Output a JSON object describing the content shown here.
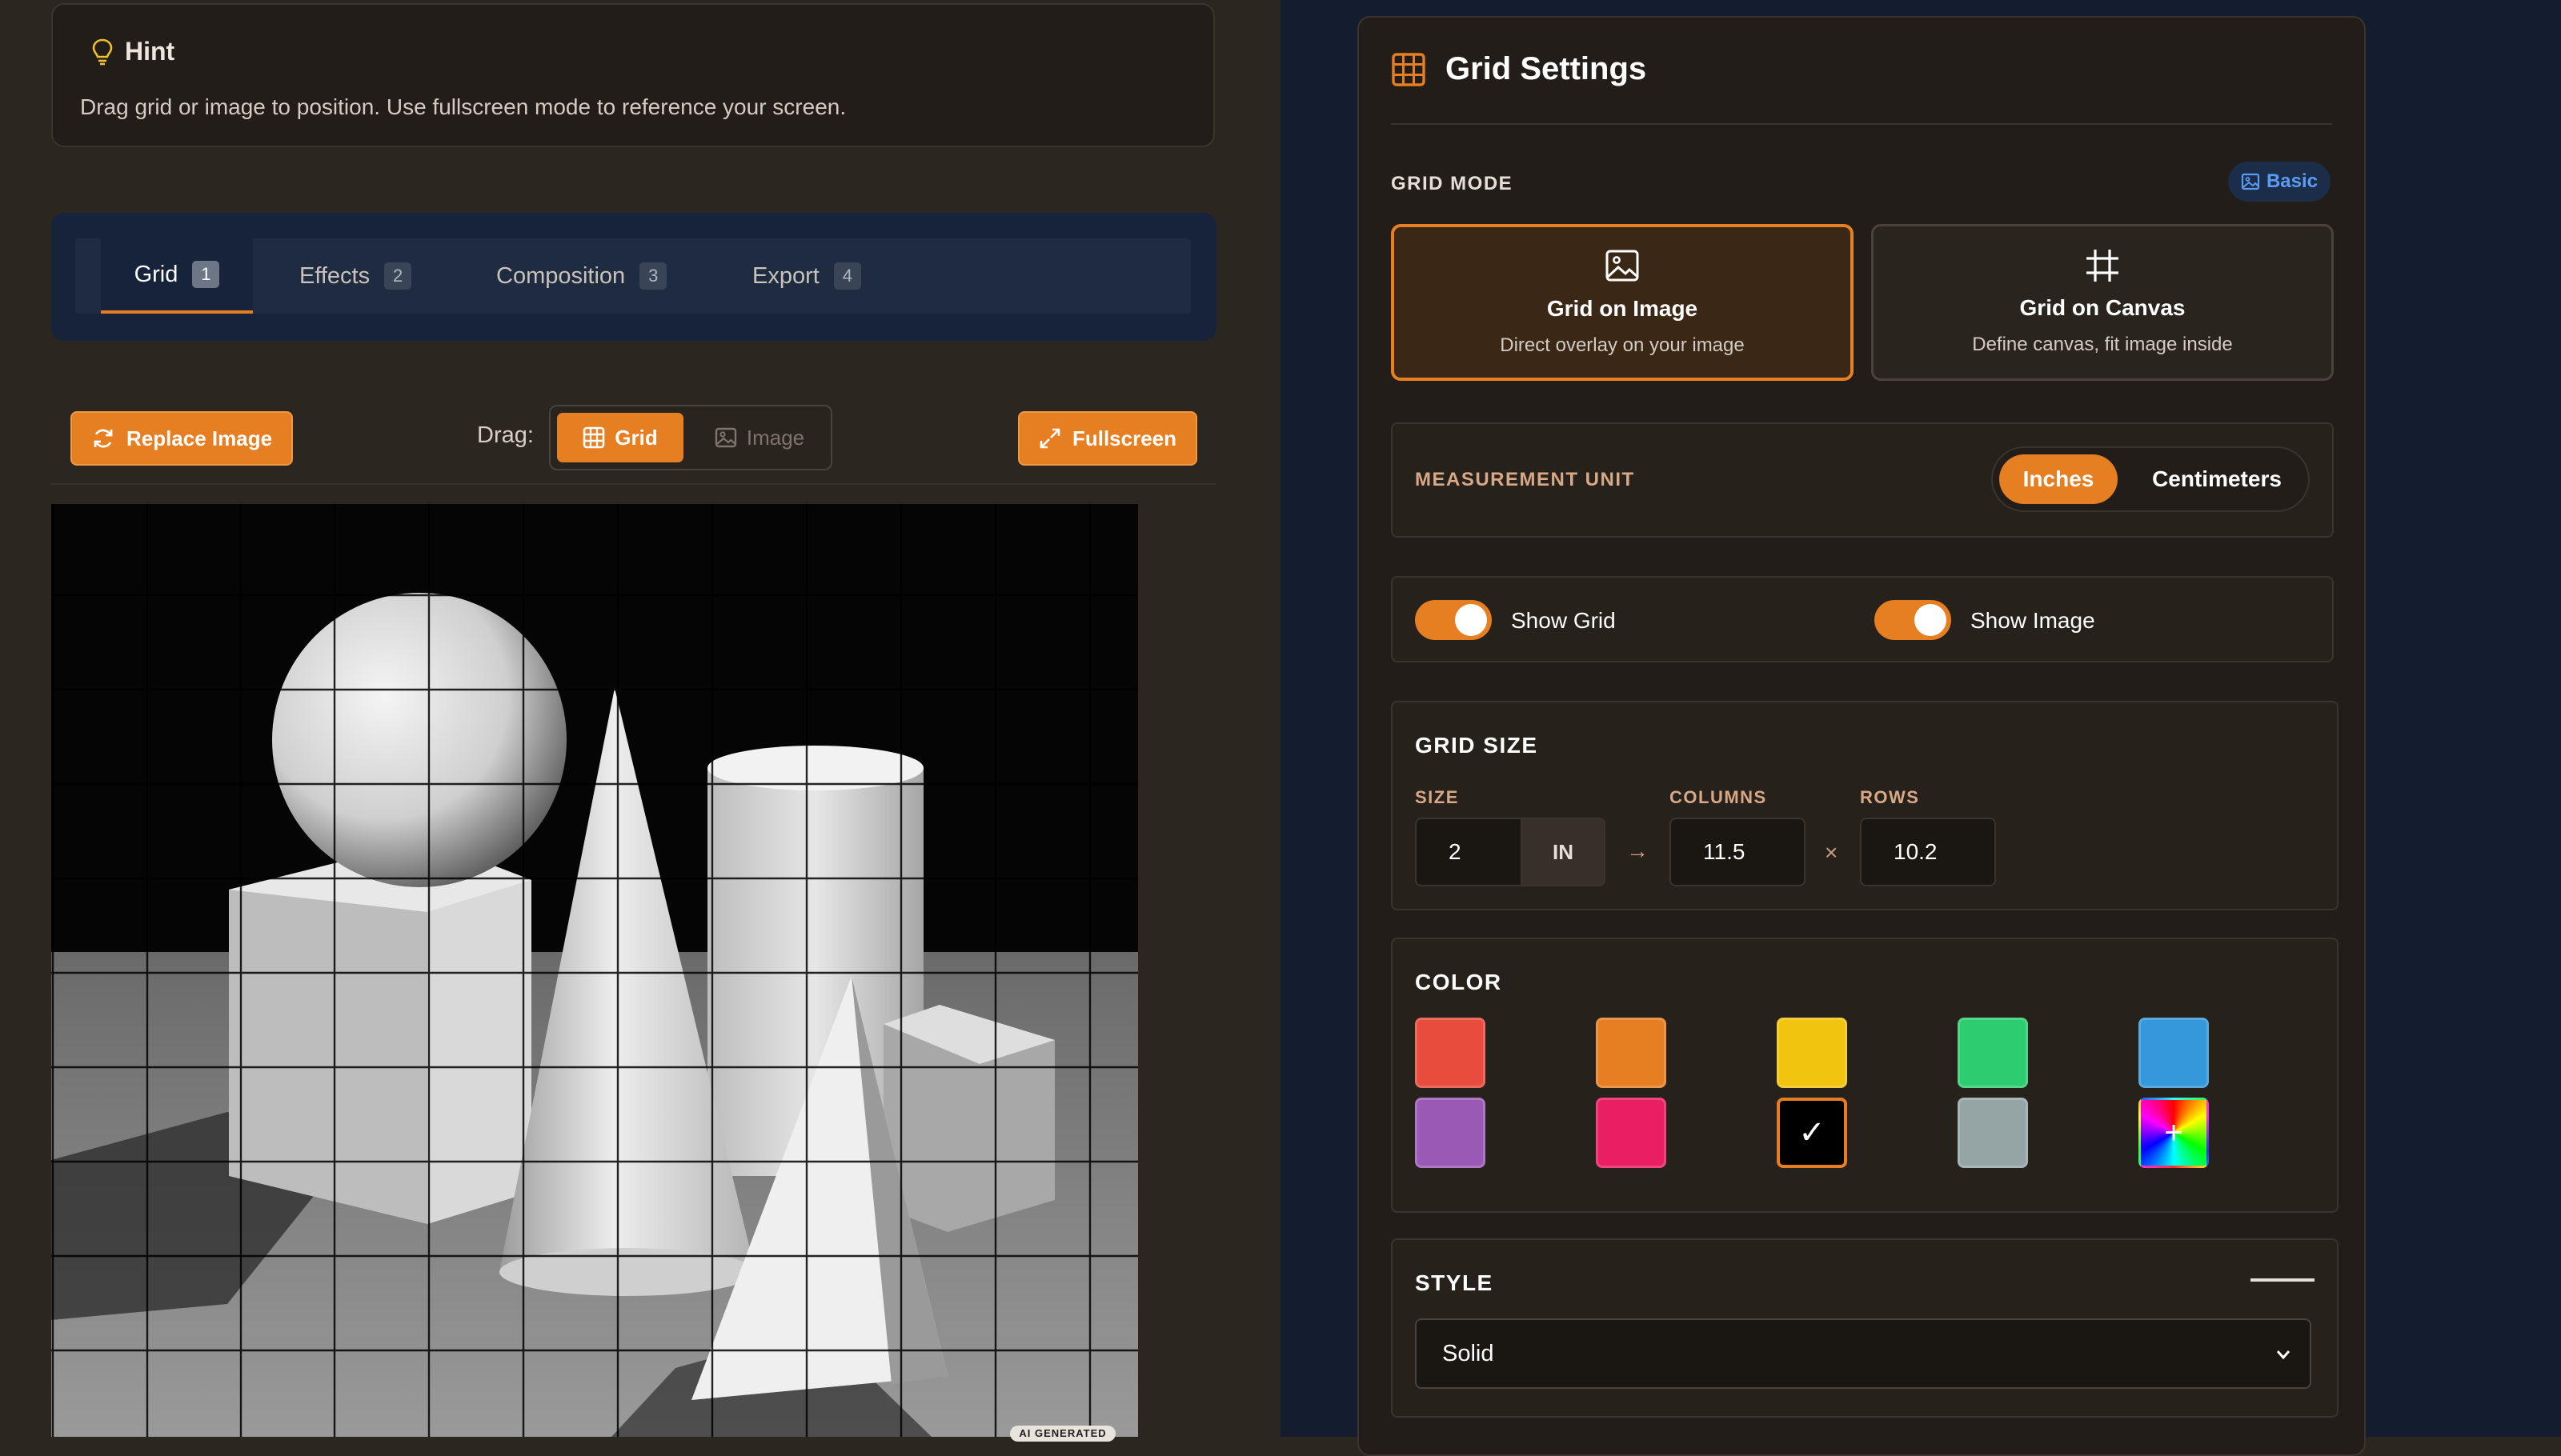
{
  "hint": {
    "title": "Hint",
    "text": "Drag grid or image to position. Use fullscreen mode to reference your screen."
  },
  "tabs": [
    {
      "label": "Grid",
      "num": "1"
    },
    {
      "label": "Effects",
      "num": "2"
    },
    {
      "label": "Composition",
      "num": "3"
    },
    {
      "label": "Export",
      "num": "4"
    }
  ],
  "toolbar": {
    "replace_label": "Replace Image",
    "drag_label": "Drag:",
    "drag_grid": "Grid",
    "drag_image": "Image",
    "fullscreen_label": "Fullscreen"
  },
  "image": {
    "ai_badge": "AI GENERATED"
  },
  "settings": {
    "title": "Grid Settings",
    "grid_mode_label": "GRID MODE",
    "basic_badge": "Basic",
    "mode_image": {
      "title": "Grid on Image",
      "sub": "Direct overlay on your image"
    },
    "mode_canvas": {
      "title": "Grid on Canvas",
      "sub": "Define canvas, fit image inside"
    },
    "unit_label": "MEASUREMENT UNIT",
    "unit_inches": "Inches",
    "unit_cm": "Centimeters",
    "show_grid": "Show Grid",
    "show_image": "Show Image",
    "grid_size_label": "GRID SIZE",
    "size_label": "SIZE",
    "size_value": "2",
    "size_unit": "IN",
    "columns_label": "COLUMNS",
    "columns_value": "11.5",
    "rows_label": "ROWS",
    "rows_value": "10.2",
    "color_label": "COLOR",
    "colors": [
      "#e74c3c",
      "#e67e22",
      "#f1c40f",
      "#2ecc71",
      "#3498db",
      "#9b59b6",
      "#e91e63",
      "#000000",
      "#95a5a6"
    ],
    "style_label": "STYLE",
    "style_value": "Solid"
  },
  "accent": "#e67e22"
}
